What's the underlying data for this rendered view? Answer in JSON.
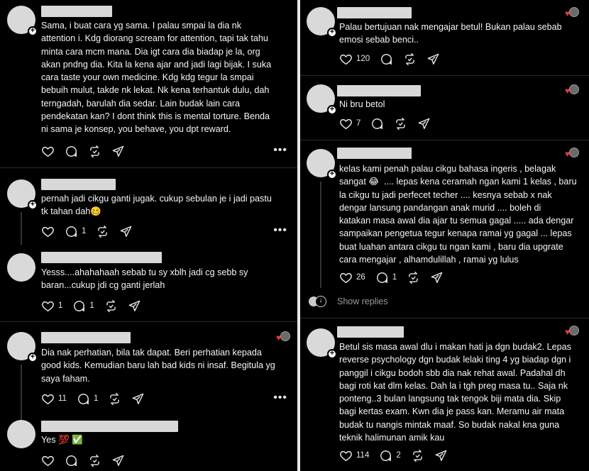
{
  "left": {
    "posts": [
      {
        "text": "Sama, i buat cara yg sama. I palau smpai la dia nk\nattention i. Kdg diorang scream for attention, tapi tak tahu\nminta cara mcm mana. Dia igt cara dia biadap je la, org\nakan pndng dia. Kita la kena ajar and jadi lagi bijak. I suka\ncara taste your own medicine. Kdg kdg tegur la smpai\nbebuih mulut, takde nk lekat. Nk kena terhantuk dulu, dah\nterngadah, barulah dia sedar. Lain budak lain cara\npendekatan kan? I dont think this is mental torture. Benda\nni sama je konsep, you behave, you dpt reward.",
        "like_count": "",
        "reply_count": ""
      },
      {
        "text": "pernah jadi cikgu ganti jugak. cukup sebulan je i jadi pastu\ntk tahan dah🥴",
        "like_count": "",
        "reply_count": "1"
      },
      {
        "text": "Yesss....ahahahaah sebab tu sy xblh jadi cg sebb sy\nbaran...cukup jdi cg ganti jerlah",
        "like_count": "1",
        "reply_count": "1"
      },
      {
        "text": "Dia nak perhatian, bila tak dapat. Beri perhatian kepada\ngood kids. Kemudian baru lah bad kids ni insaf. Begitula yg\nsaya faham.",
        "like_count": "11",
        "reply_count": "1"
      },
      {
        "text": "Yes 💯 ✅",
        "like_count": "",
        "reply_count": ""
      }
    ]
  },
  "right": {
    "posts": [
      {
        "text": "Palau bertujuan nak mengajar betul! Bukan palau sebab\nemosi sebab benci..",
        "like_count": "120",
        "reply_count": ""
      },
      {
        "text": "Ni bru betol",
        "like_count": "7",
        "reply_count": ""
      },
      {
        "text": "kelas kami penah palau cikgu bahasa ingeris , belagak\nsangat 😂  .... lepas kena ceramah ngan kami 1 kelas , baru\nla cikgu tu jadi perfecet techer .... kesnya sebab x nak\ndengar lansung pandangan anak murid .... boleh di\nkatakan masa awal dia ajar tu semua gagal ..... ada dengar\nsampaikan pengetua tegur kenapa ramai yg gagal ... lepas\nbuat luahan antara cikgu tu ngan kami , baru dia upgrate\ncara mengajar , alhamdulillah , ramai yg lulus",
        "like_count": "26",
        "reply_count": "1"
      },
      {
        "text": "Betul sis masa awal dlu i makan hati ja dgn budak2. Lepas\nreverse psychology dgn budak lelaki ting 4 yg biadap dgn i\npanggil i cikgu bodoh sbb dia nak rehat awal. Padahal dh\nbagi roti kat dlm kelas. Dah la i tgh preg masa tu.. Saja nk\nponteng..3 bulan langsung tak tengok biji mata dia. Skip\nbagi kertas exam. Kwn dia je pass kan. Meramu air mata\nbudak tu nangis mintak maaf. So budak nakal kna guna\nteknik halimunan amik kau",
        "like_count": "114",
        "reply_count": "2"
      }
    ],
    "show_replies": "Show replies"
  },
  "icons": {
    "like": "heart-icon",
    "reply": "comment-icon",
    "repost": "repost-icon",
    "share": "send-icon",
    "more": "more-icon"
  },
  "colors": {
    "background": "#000000",
    "text": "#f3f5f7",
    "liked_heart": "#ff3040"
  }
}
